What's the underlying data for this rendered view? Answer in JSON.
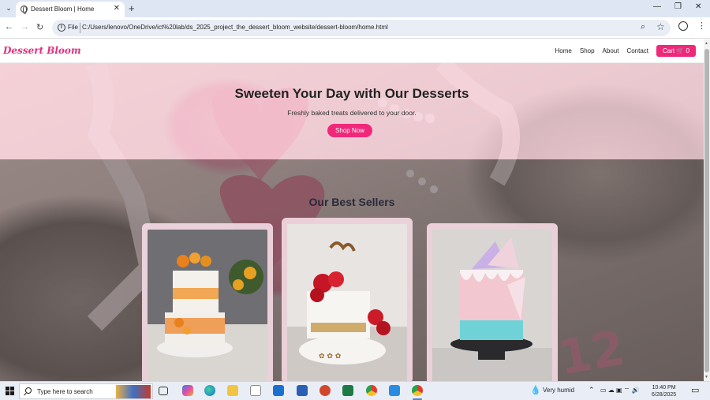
{
  "browser": {
    "tab_title": "Dessert Bloom | Home",
    "tab_close": "✕",
    "new_tab": "+",
    "window_controls": {
      "minimize": "—",
      "restore": "❐",
      "close": "✕"
    },
    "nav": {
      "back": "←",
      "forward": "→",
      "reload": "↻"
    },
    "address": {
      "scheme_label": "File",
      "url": "C:/Users/lenovo/OneDrive/ict%20lab/ds_2025_project_the_dessert_bloom_website/dessert-bloom/home.html"
    }
  },
  "site": {
    "logo": "Dessert Bloom",
    "nav_links": [
      "Home",
      "Shop",
      "About",
      "Contact"
    ],
    "cart": {
      "label": "Cart 🛒 0"
    }
  },
  "hero": {
    "heading": "Sweeten Your Day with Our Desserts",
    "subheading": "Freshly baked treats delivered to your door.",
    "cta": "Shop Now"
  },
  "best_sellers": {
    "title": "Our Best Sellers",
    "cards": [
      {
        "name": "orange-floral-tier-cake"
      },
      {
        "name": "red-rose-white-cake"
      },
      {
        "name": "pastel-drip-cake"
      }
    ]
  },
  "taskbar": {
    "search_placeholder": "Type here to search",
    "weather": "Very humid",
    "time": "10:40 PM",
    "date": "6/28/2025",
    "icons": [
      "task-view-icon",
      "copilot-icon",
      "edge-icon",
      "file-explorer-icon",
      "store-icon",
      "outlook-icon",
      "word-icon",
      "powerpoint-icon",
      "excel-icon",
      "chrome-icon",
      "vscode-icon",
      "chrome-active-icon"
    ],
    "colors": {
      "accent": "#f0287a",
      "logo": "#e0307e"
    }
  }
}
